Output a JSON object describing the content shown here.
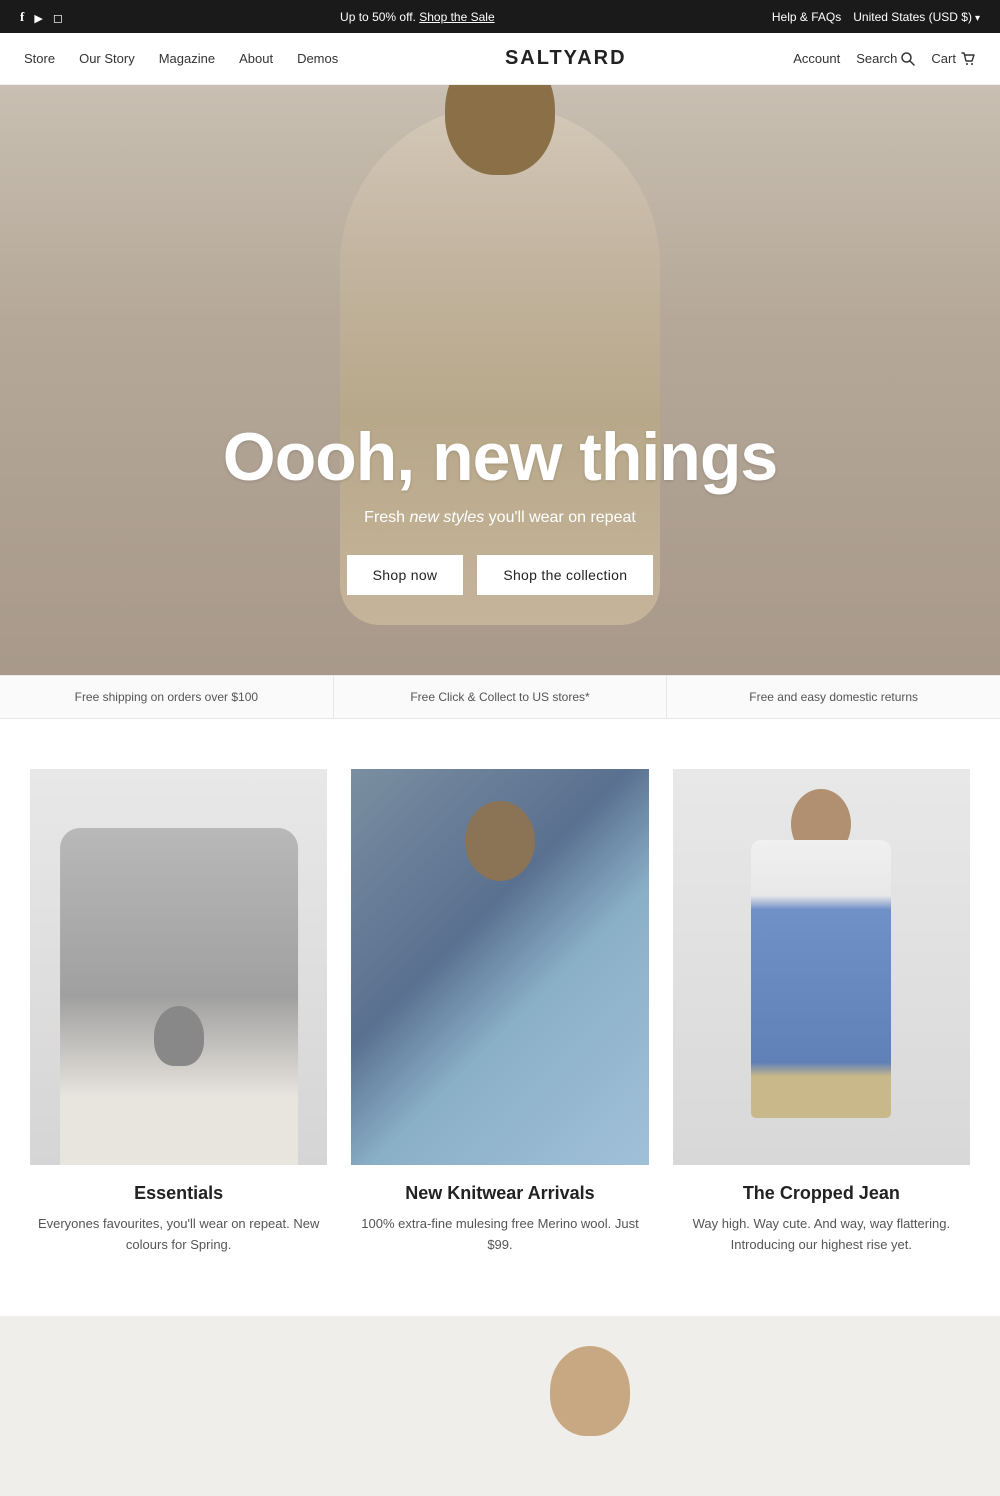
{
  "announcement": {
    "promo_text": "Up to 50% off. ",
    "promo_link_text": "Shop the Sale",
    "help_label": "Help & FAQs",
    "region_label": "United States (USD $)",
    "social_icons": [
      "facebook",
      "youtube",
      "instagram"
    ]
  },
  "nav": {
    "brand": "SALTYARD",
    "links": [
      "Store",
      "Our Story",
      "Magazine",
      "About",
      "Demos"
    ],
    "account_label": "Account",
    "search_label": "Search",
    "cart_label": "Cart"
  },
  "hero": {
    "headline": "Oooh, new things",
    "subtext_prefix": "Fresh ",
    "subtext_italic": "new styles",
    "subtext_suffix": " you'll wear on repeat",
    "btn_shop_now": "Shop now",
    "btn_shop_collection": "Shop the collection"
  },
  "info_bar": {
    "items": [
      "Free shipping on orders over $100",
      "Free Click & Collect to US stores*",
      "Free and easy domestic returns"
    ]
  },
  "products": [
    {
      "title": "Essentials",
      "description": "Everyones favourites, you'll wear on repeat.\nNew colours for Spring.",
      "image_class": "essentials"
    },
    {
      "title": "New Knitwear Arrivals",
      "description": "100% extra-fine mulesing free Merino wool.\nJust $99.",
      "image_class": "knitwear"
    },
    {
      "title": "The Cropped Jean",
      "description": "Way high. Way cute. And way, way flattering.\nIntroducing our highest rise yet.",
      "image_class": "jean"
    }
  ]
}
